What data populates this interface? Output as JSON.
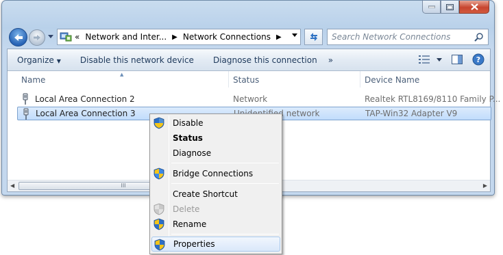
{
  "window": {
    "caption_buttons": [
      "minimize",
      "maximize",
      "close"
    ]
  },
  "navigation": {
    "breadcrumbs": [
      "Network and Inter...",
      "Network Connections"
    ],
    "overflow_marker": "«",
    "search_placeholder": "Search Network Connections"
  },
  "toolbar": {
    "organize_label": "Organize",
    "disable_label": "Disable this network device",
    "diagnose_label": "Diagnose this connection",
    "more_label": "»"
  },
  "columns": {
    "name": "Name",
    "status": "Status",
    "device": "Device Name"
  },
  "connections": [
    {
      "name": "Local Area Connection 2",
      "status": "Network",
      "device": "Realtek RTL8169/8110 Family P...",
      "selected": false
    },
    {
      "name": "Local Area Connection 3",
      "status": "Unidentified network",
      "device": "TAP-Win32 Adapter V9",
      "selected": true
    }
  ],
  "scrollbar": {
    "thumb_grip": "III"
  },
  "context_menu": {
    "items": [
      {
        "label": "Disable",
        "icon": "shield-icon",
        "bold": false,
        "disabled": false
      },
      {
        "label": "Status",
        "icon": "",
        "bold": true,
        "disabled": false
      },
      {
        "label": "Diagnose",
        "icon": "",
        "bold": false,
        "disabled": false
      },
      {
        "label": "Bridge Connections",
        "icon": "shield-icon",
        "bold": false,
        "disabled": false
      },
      {
        "label": "Create Shortcut",
        "icon": "",
        "bold": false,
        "disabled": false
      },
      {
        "label": "Delete",
        "icon": "shield-icon",
        "bold": false,
        "disabled": true
      },
      {
        "label": "Rename",
        "icon": "shield-icon",
        "bold": false,
        "disabled": false
      },
      {
        "label": "Properties",
        "icon": "shield-icon",
        "bold": false,
        "disabled": false,
        "highlighted": true
      }
    ]
  },
  "colors": {
    "selection": "#c1dcfc",
    "toolbar_text": "#1e395b",
    "close_button": "#c7452f"
  }
}
